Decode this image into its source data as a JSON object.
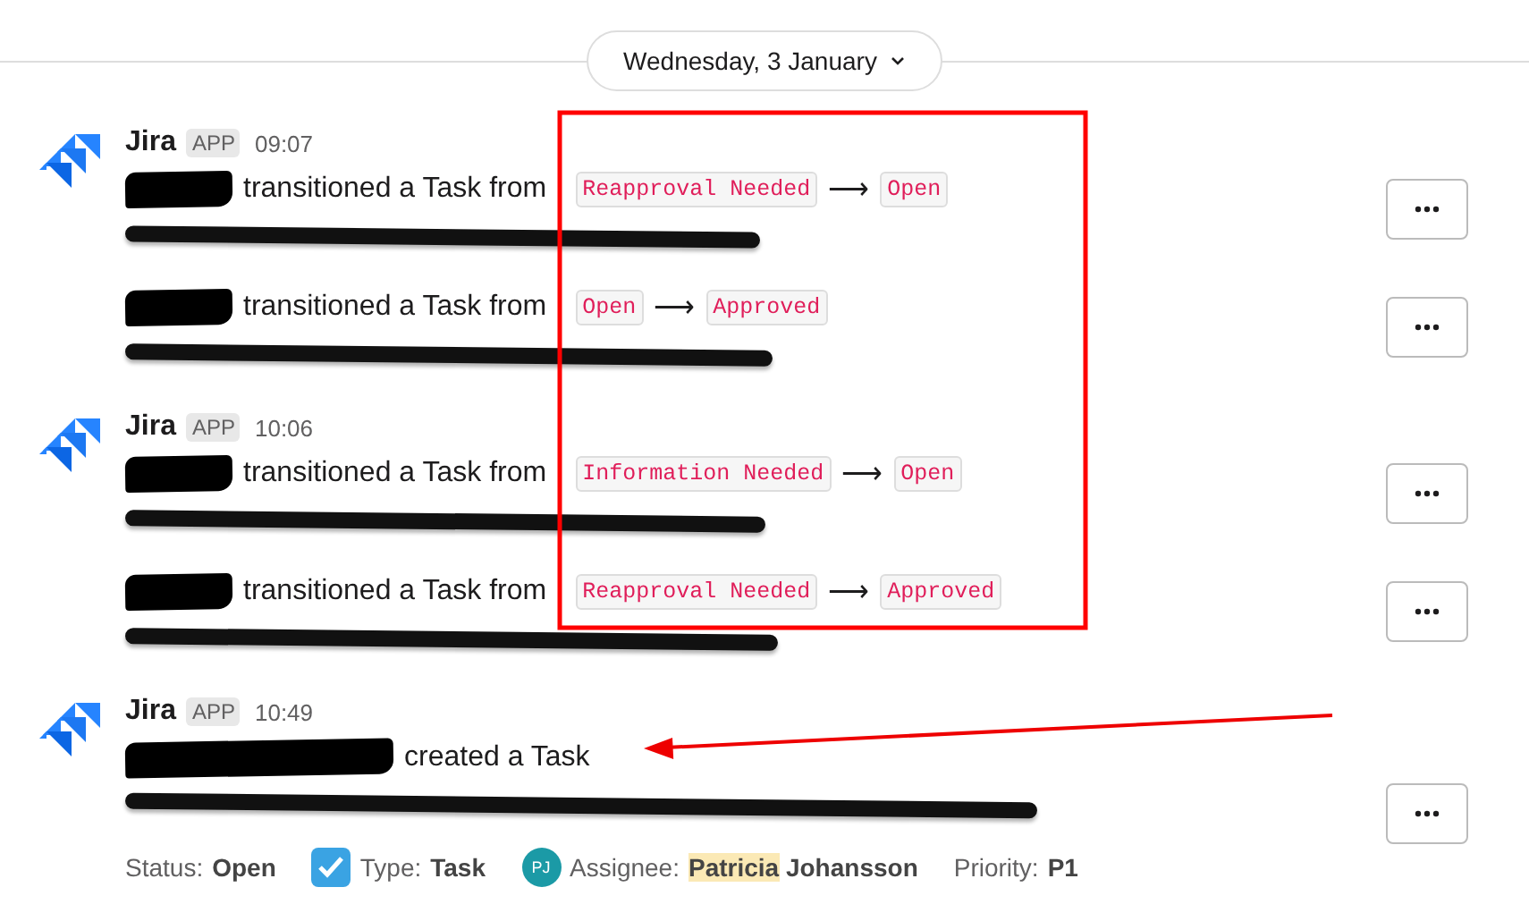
{
  "date_divider": {
    "label": "Wednesday, 3 January"
  },
  "groups": [
    {
      "sender": "Jira",
      "badge": "APP",
      "time": "09:07",
      "items": [
        {
          "kind": "transition",
          "action": "transitioned a Task from",
          "from_status": "Reapproval Needed",
          "arrow": "⟶",
          "to_status": "Open"
        },
        {
          "kind": "transition",
          "action": "transitioned a Task from",
          "from_status": "Open",
          "arrow": "⟶",
          "to_status": "Approved"
        }
      ]
    },
    {
      "sender": "Jira",
      "badge": "APP",
      "time": "10:06",
      "items": [
        {
          "kind": "transition",
          "action": "transitioned a Task from",
          "from_status": "Information Needed",
          "arrow": "⟶",
          "to_status": "Open"
        },
        {
          "kind": "transition",
          "action": "transitioned a Task from",
          "from_status": "Reapproval Needed",
          "arrow": "⟶",
          "to_status": "Approved"
        }
      ]
    },
    {
      "sender": "Jira",
      "badge": "APP",
      "time": "10:49",
      "items": [
        {
          "kind": "created",
          "action": "created a Task",
          "fields": [
            {
              "kind": "text",
              "label": "Status:",
              "value": "Open"
            },
            {
              "kind": "checkbox",
              "label": "Type:",
              "value": "Task"
            },
            {
              "kind": "person",
              "label": "Assignee:",
              "initials": "PJ",
              "parts": [
                {
                  "text": "Patricia",
                  "highlighted": true
                },
                {
                  "text": "Johansson",
                  "highlighted": false
                }
              ]
            },
            {
              "kind": "text",
              "label": "Priority:",
              "value": "P1"
            }
          ]
        }
      ]
    }
  ],
  "annotations": {
    "box": true,
    "arrow": true
  }
}
